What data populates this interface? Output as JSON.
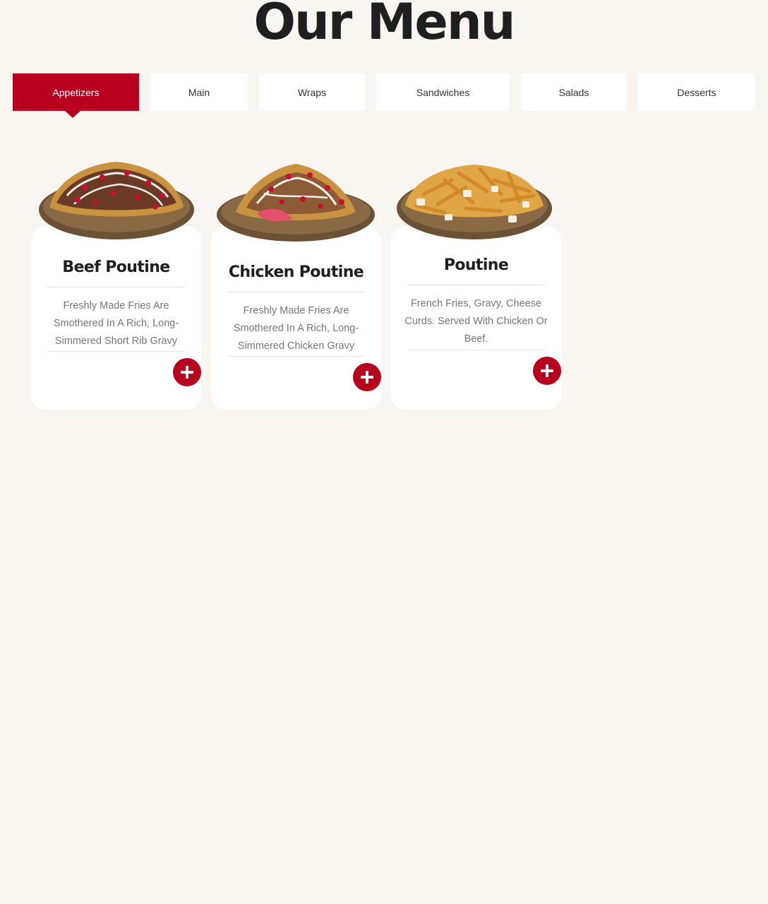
{
  "page": {
    "title": "Our Menu"
  },
  "colors": {
    "accent": "#b8001f",
    "background": "#f9f6f1",
    "card": "#ffffff"
  },
  "tabs": [
    {
      "label": "Appetizers",
      "active": true
    },
    {
      "label": "Main",
      "active": false
    },
    {
      "label": "Wraps",
      "active": false
    },
    {
      "label": "Sandwiches",
      "active": false
    },
    {
      "label": "Salads",
      "active": false
    },
    {
      "label": "Desserts",
      "active": false
    }
  ],
  "items": [
    {
      "name": "Beef Poutine",
      "description": "Freshly Made Fries Are Smothered In A Rich, Long-Simmered Short Rib Gravy",
      "image": "beef-poutine-image",
      "add_icon": "plus-icon"
    },
    {
      "name": "Chicken Poutine",
      "description": "Freshly Made Fries Are Smothered In A Rich, Long-Simmered Chicken Gravy",
      "image": "chicken-poutine-image",
      "add_icon": "plus-icon"
    },
    {
      "name": "Poutine",
      "description": "French Fries, Gravy, Cheese Curds. Served With Chicken Or Beef.",
      "image": "poutine-image",
      "add_icon": "plus-icon"
    }
  ]
}
